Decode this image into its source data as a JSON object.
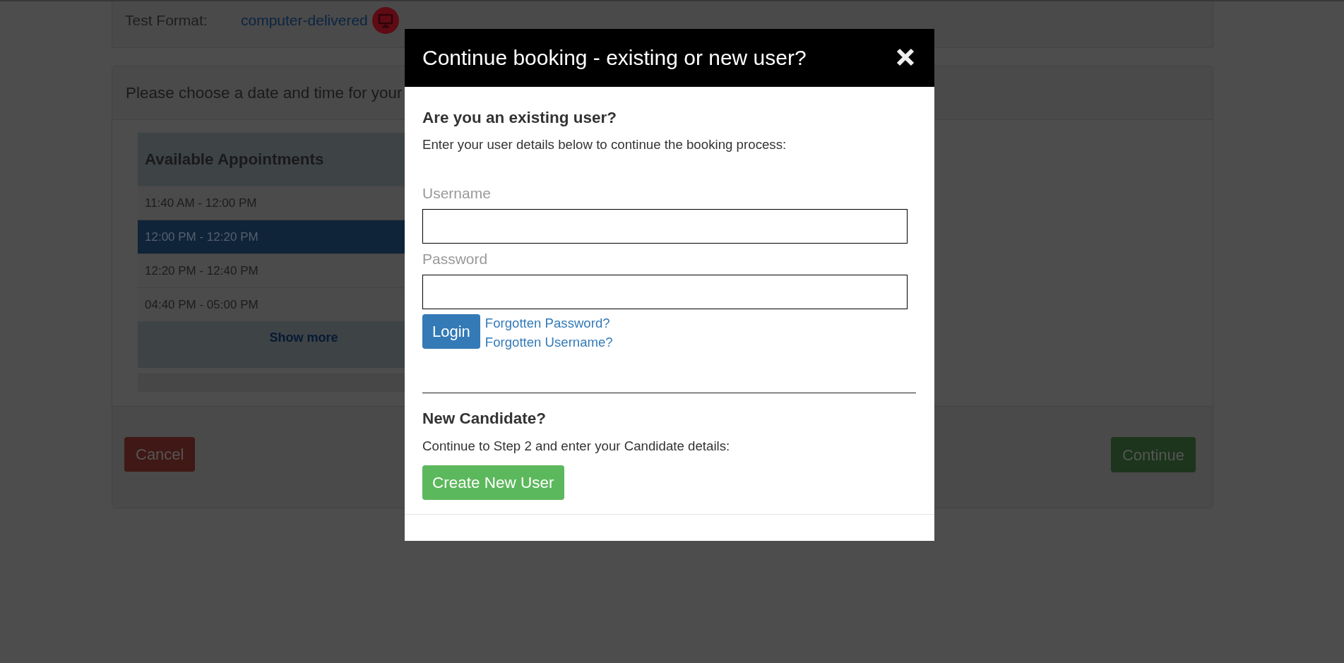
{
  "test_format": {
    "label": "Test Format:",
    "value": "computer-delivered"
  },
  "booking": {
    "heading": "Please choose a date and time for your",
    "appointments": {
      "title": "Available Appointments",
      "slots": [
        {
          "time": "11:40 AM - 12:00 PM",
          "selected": false
        },
        {
          "time": "12:00 PM - 12:20 PM",
          "selected": true
        },
        {
          "time": "12:20 PM - 12:40 PM",
          "selected": false
        },
        {
          "time": "04:40 PM - 05:00 PM",
          "selected": false
        }
      ],
      "show_more": "Show more"
    },
    "buttons": [
      {
        "label": "Cancel",
        "kind": "cancel"
      },
      {
        "label": "Continue",
        "kind": "continue"
      }
    ]
  },
  "dialog": {
    "title": "Continue booking - existing or new user?",
    "existing_user": {
      "heading": "Are you an existing user?",
      "text": "Enter your user details below to continue the booking process:",
      "fields": [
        {
          "label": "Username"
        },
        {
          "label": "Password"
        }
      ],
      "login_button": "Login",
      "links": [
        "Forgotten Password?",
        "Forgotten Username?"
      ]
    },
    "new_candidate": {
      "heading": "New Candidate?",
      "text": "Continue to Step 2 and enter your Candidate details:",
      "button": "Create New User"
    }
  }
}
